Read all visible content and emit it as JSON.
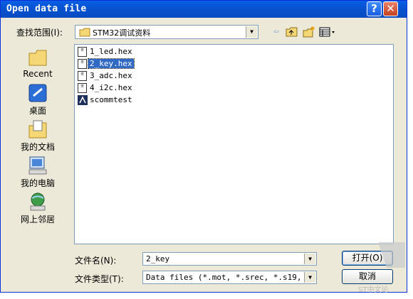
{
  "window": {
    "title": "Open data file"
  },
  "titlebar": {
    "help_glyph": "?",
    "close_glyph": "✕"
  },
  "lookin": {
    "label": "查找范围(I):",
    "value": "STM32调试资料"
  },
  "places": [
    {
      "label": "Recent",
      "icon": "recent-folder-icon"
    },
    {
      "label": "桌面",
      "icon": "desktop-icon"
    },
    {
      "label": "我的文档",
      "icon": "my-documents-icon"
    },
    {
      "label": "我的电脑",
      "icon": "my-computer-icon"
    },
    {
      "label": "网上邻居",
      "icon": "network-places-icon"
    }
  ],
  "files": [
    {
      "name": "1_led.hex",
      "icon": "hex-file-icon",
      "selected": false
    },
    {
      "name": "2_key.hex",
      "icon": "hex-file-icon",
      "selected": true
    },
    {
      "name": "3_adc.hex",
      "icon": "hex-file-icon",
      "selected": false
    },
    {
      "name": "4_i2c.hex",
      "icon": "hex-file-icon",
      "selected": false
    },
    {
      "name": "scommtest",
      "icon": "application-icon",
      "selected": false
    }
  ],
  "filename": {
    "label": "文件名(N):",
    "value": "2_key"
  },
  "filetype": {
    "label": "文件类型(T):",
    "value": "Data files (*.mot, *.srec, *.s19, *.s"
  },
  "buttons": {
    "open": "打开(O)",
    "cancel": "取消"
  },
  "watermark": "ST中文论"
}
